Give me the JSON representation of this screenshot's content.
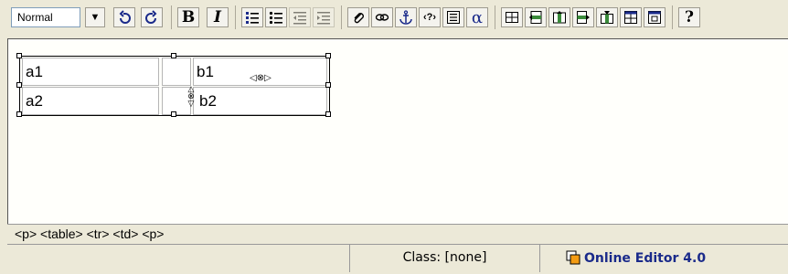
{
  "toolbar": {
    "format_select": {
      "value": "Normal"
    },
    "buttons": [
      "undo-icon",
      "redo-icon",
      "bold-icon",
      "italic-icon",
      "numbered-list-icon",
      "bullet-list-icon",
      "outdent-icon",
      "indent-icon",
      "attachment-icon",
      "link-icon",
      "anchor-icon",
      "code-icon",
      "form-icon",
      "special-char-icon",
      "insert-table-icon",
      "row-icon",
      "column-icon",
      "insert-row-icon",
      "insert-column-icon",
      "cell-properties-icon",
      "table-properties-icon",
      "help-icon"
    ],
    "bold_glyph": "B",
    "italic_glyph": "I",
    "alpha_glyph": "α",
    "help_glyph": "?"
  },
  "editor": {
    "table": {
      "rows": [
        [
          "a1",
          "",
          "b1"
        ],
        [
          "a2",
          "",
          "b2"
        ]
      ]
    }
  },
  "pathbar": {
    "path": "<p> <table> <tr> <td> <p>"
  },
  "statusbar": {
    "class_label": "Class: [none]",
    "brand": "Online Editor 4.0",
    "brand_color": "#1a2a8a"
  }
}
